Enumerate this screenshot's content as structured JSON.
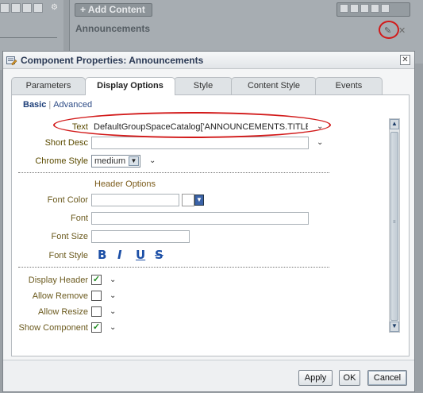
{
  "background": {
    "add_content": "+ Add Content",
    "region_title": "Announcements"
  },
  "dialog": {
    "title": "Component Properties: Announcements",
    "tabs": [
      {
        "label": "Parameters"
      },
      {
        "label": "Display Options"
      },
      {
        "label": "Style"
      },
      {
        "label": "Content Style"
      },
      {
        "label": "Events"
      }
    ],
    "active_tab": "Display Options",
    "subtabs": {
      "basic": "Basic",
      "separator": "|",
      "advanced": "Advanced"
    },
    "fields": {
      "text": {
        "label": "Text",
        "value": "DefaultGroupSpaceCatalog['ANNOUNCEMENTS.TITLE']}"
      },
      "short_desc": {
        "label": "Short Desc",
        "value": ""
      },
      "chrome_style": {
        "label": "Chrome Style",
        "value": "medium"
      }
    },
    "header_options_title": "Header Options",
    "header_fields": {
      "font_color": {
        "label": "Font Color",
        "value": ""
      },
      "font": {
        "label": "Font",
        "value": ""
      },
      "font_size": {
        "label": "Font Size",
        "value": ""
      },
      "font_style": {
        "label": "Font Style",
        "buttons": [
          "B",
          "I",
          "U",
          "S"
        ]
      }
    },
    "checkboxes": [
      {
        "label": "Display Header",
        "checked": true,
        "mark": "✓"
      },
      {
        "label": "Allow Remove",
        "checked": false,
        "mark": ""
      },
      {
        "label": "Allow Resize",
        "checked": false,
        "mark": ""
      },
      {
        "label": "Show Component",
        "checked": true,
        "mark": "✓"
      }
    ],
    "buttons": {
      "apply": "Apply",
      "ok": "OK",
      "cancel": "Cancel"
    }
  },
  "icons": {
    "dialog": "properties-icon",
    "close": "close-icon",
    "chevron": "chevron-down-icon",
    "wrench": "wrench-icon"
  },
  "colors": {
    "highlight_oval": "#d21a1a",
    "check": "#1e8a1e",
    "link": "#2e4c86",
    "font_style": "#1c4fa6"
  }
}
